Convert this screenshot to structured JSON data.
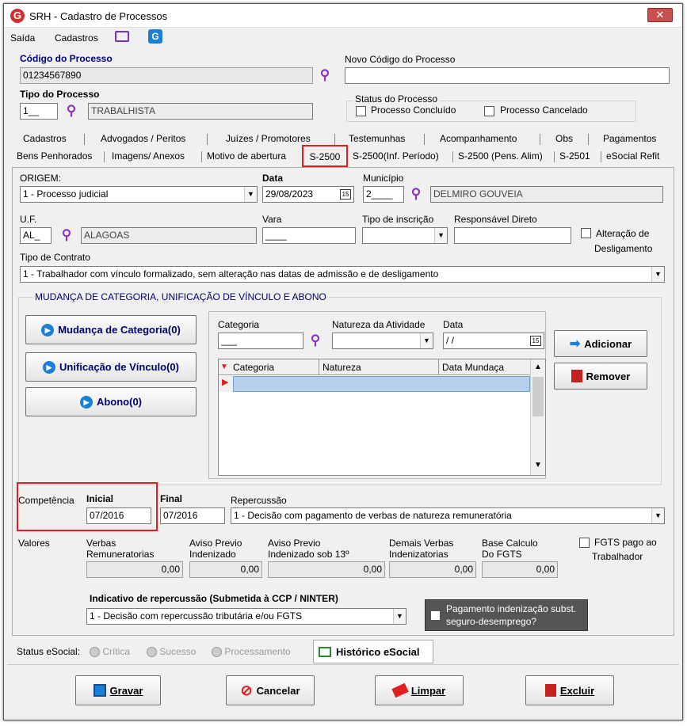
{
  "window": {
    "title": "SRH - Cadastro de Processos",
    "app_icon": "G",
    "close": "✕"
  },
  "menu": {
    "items": [
      "Saída",
      "Cadastros"
    ]
  },
  "codigo": {
    "label": "Código do Processo",
    "value": "01234567890"
  },
  "novo_codigo": {
    "label": "Novo Código do Processo",
    "value": ""
  },
  "tipo": {
    "label": "Tipo do Processo",
    "code": "1__",
    "desc": "TRABALHISTA"
  },
  "status_proc": {
    "title": "Status do Processo",
    "concluido": "Processo Concluído",
    "cancelado": "Processo Cancelado"
  },
  "tabs_row1": [
    "Cadastros",
    "Advogados / Peritos",
    "Juízes / Promotores",
    "Testemunhas",
    "Acompanhamento",
    "Obs",
    "Pagamentos"
  ],
  "tabs_row2": [
    "Bens Penhorados",
    "Imagens/ Anexos",
    "Motivo de abertura",
    "S-2500",
    "S-2500(Inf. Período)",
    "S-2500 (Pens. Alim)",
    "S-2501",
    "eSocial Refit"
  ],
  "form": {
    "origem_label": "ORIGEM:",
    "origem_value": "1 - Processo judicial",
    "data_label": "Data",
    "data_value": "29/08/2023",
    "municipio_label": "Município",
    "municipio_code": "2____",
    "municipio_desc": "DELMIRO GOUVEIA",
    "uf_label": "U.F.",
    "uf_code": "AL_",
    "uf_desc": "ALAGOAS",
    "vara_label": "Vara",
    "vara_value": "____",
    "tipo_insc_label": "Tipo de inscrição",
    "tipo_insc_value": "",
    "resp_label": "Responsável Direto",
    "resp_value": "",
    "alteracao_label_1": "Alteração de",
    "alteracao_label_2": "Desligamento",
    "contrato_label": "Tipo de Contrato",
    "contrato_value": "1 - Trabalhador com vínculo formalizado, sem alteração nas datas de admissão e de desligamento"
  },
  "mudanca": {
    "title": "MUDANÇA DE CATEGORIA, UNIFICAÇÃO DE VÍNCULO E ABONO",
    "btn_categoria": "Mudança de Categoria(0)",
    "btn_unificacao": "Unificação de Vínculo(0)",
    "btn_abono": "Abono(0)",
    "categoria_label": "Categoria",
    "categoria_value": "___",
    "natureza_label": "Natureza da Atividade",
    "data_label": "Data",
    "data_value": " / /",
    "adicionar": "Adicionar",
    "remover": "Remover",
    "grid_columns": [
      "Categoria",
      "Natureza",
      "Data Mundaça"
    ]
  },
  "competencia": {
    "label": "Competência",
    "inicial_label": "Inicial",
    "inicial_value": "07/2016",
    "final_label": "Final",
    "final_value": "07/2016",
    "repercussao_label": "Repercussão",
    "repercussao_value": "1 - Decisão com pagamento de verbas de natureza remuneratória"
  },
  "valores": {
    "label": "Valores",
    "verbas_l1": "Verbas",
    "verbas_l2": "Remuneratorias",
    "verbas": "0,00",
    "aviso_l1": "Aviso Previo",
    "aviso_l2": "Indenizado",
    "aviso": "0,00",
    "aviso13_l1": "Aviso Previo",
    "aviso13_l2": "Indenizado sob 13º",
    "aviso13": "0,00",
    "demais_l1": "Demais Verbas",
    "demais_l2": "Indenizatorias",
    "demais": "0,00",
    "base_l1": "Base Calculo",
    "base_l2": "Do FGTS",
    "base": "0,00",
    "fgts_l1": "FGTS pago ao",
    "fgts_l2": "Trabalhador"
  },
  "indicativo": {
    "label": "Indicativo de repercussão (Submetida à CCP / NINTER)",
    "value": "1 - Decisão com repercussão tributária e/ou FGTS",
    "pagamento_l1": "Pagamento indenização subst.",
    "pagamento_l2": "seguro-desemprego?"
  },
  "status_esocial": {
    "label": "Status eSocial:",
    "critica": "Crítica",
    "sucesso": "Sucesso",
    "processamento": "Processamento",
    "historico": "Histórico eSocial"
  },
  "actions": {
    "gravar": "Gravar",
    "cancelar": "Cancelar",
    "limpar": "Limpar",
    "excluir": "Excluir"
  }
}
